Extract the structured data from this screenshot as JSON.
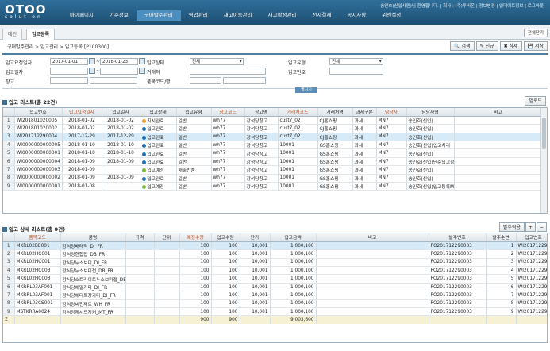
{
  "app": {
    "logo": "OTOO",
    "logo_sub": "solution",
    "user_info": "송인호(신입사원)님 환영합니다. | 회사 : (주)투비온 | 정보변경 | 업데이트정보 | 로그아웃"
  },
  "menu": [
    "마이페이지",
    "기준정보",
    "구매발주관리",
    "영업관리",
    "재고이동관리",
    "재고확정관리",
    "전자결재",
    "공지사항",
    "위젠설정"
  ],
  "tabs": {
    "home": "메인",
    "active": "입고등록",
    "fold": "전체닫기"
  },
  "breadcrumb": "구매발주관리 > 입고관리 > 입고등록 [P100300]",
  "toolbar": {
    "search": "검색",
    "new": "신규",
    "delete": "삭제",
    "save": "저장"
  },
  "search": {
    "receipt_date_label": "입고요청일자",
    "date_from": "2017-01-01",
    "tilde": "~",
    "date_to": "2018-01-23",
    "receipt_status_label": "입고상태",
    "receipt_status_value": "전체",
    "receipt_type_label": "입고유형",
    "receipt_type_value": "전체",
    "in_date_label": "입고일자",
    "client_label": "거래처",
    "in_no_label": "입고번호",
    "warehouse_label": "창고",
    "item_code_label": "품목코드/명",
    "expand": "펼치기"
  },
  "list": {
    "title": "입고 리스트(총 22건)",
    "upload": "업로드",
    "columns": [
      "입고번호",
      "입고요청일자",
      "입고일자",
      "입고상태",
      "입고유형",
      "창고코드",
      "창고명",
      "거래처코드",
      "거래처명",
      "과세구분",
      "담당자",
      "담당자명",
      "비고"
    ],
    "rows": [
      {
        "no": "1",
        "c": [
          "WI201801020005",
          "2018-01-02",
          "2018-01-02",
          "지시완료",
          "일반",
          "wh77",
          "강석당창고",
          "cust7_02",
          "CJ홈쇼핑",
          "과세",
          "MN7",
          "송인호(신입)",
          ""
        ],
        "dot": "#f0a030"
      },
      {
        "no": "2",
        "c": [
          "WI201801020002",
          "2018-01-02",
          "2018-01-02",
          "입고완료",
          "일반",
          "wh77",
          "강석당창고",
          "cust7_02",
          "CJ홈쇼핑",
          "과세",
          "MN7",
          "송인호(신입)",
          ""
        ],
        "dot": "#1f6fb8"
      },
      {
        "no": "3",
        "c": [
          "WI201712290004",
          "2017-12-29",
          "2017-12-29",
          "입고완료",
          "일반",
          "wh77",
          "강석당창고",
          "cust7_02",
          "CJ홈쇼핑",
          "과세",
          "MN7",
          "송인호(신입)",
          ""
        ],
        "dot": "#1f6fb8",
        "selected": true
      },
      {
        "no": "4",
        "c": [
          "WI0000000000005",
          "2018-01-10",
          "2018-01-10",
          "입고완료",
          "일반",
          "wh77",
          "강석당창고",
          "10001",
          "GS홈쇼핑",
          "과세",
          "MN7",
          "송인호(신입)입고처리",
          ""
        ],
        "dot": "#1f6fb8"
      },
      {
        "no": "5",
        "c": [
          "WI0000000000001",
          "2018-01-10",
          "2018-01-10",
          "입고완료",
          "일반",
          "wh77",
          "강석당창고",
          "10001",
          "GS홈쇼핑",
          "과세",
          "MN7",
          "송인호(신입)",
          ""
        ],
        "dot": "#1f6fb8"
      },
      {
        "no": "6",
        "c": [
          "WI0000000000004",
          "2018-01-09",
          "2018-01-09",
          "입고완료",
          "일반",
          "wh77",
          "강석당창고",
          "10001",
          "GS홈쇼핑",
          "과세",
          "MN7",
          "송인호(신입)단순입고함니다.",
          ""
        ],
        "dot": "#1f6fb8"
      },
      {
        "no": "7",
        "c": [
          "WI0000000000003",
          "2018-01-09",
          "",
          "입고예정",
          "매출반품",
          "wh77",
          "강석당창고",
          "10001",
          "GS홈쇼핑",
          "과세",
          "MN7",
          "송인호(신입)",
          ""
        ],
        "dot": "#7dbb3c"
      },
      {
        "no": "8",
        "c": [
          "WI0000000000002",
          "2018-01-09",
          "2018-01-09",
          "입고완료",
          "일반",
          "wh77",
          "강석당창고",
          "10001",
          "GS홈쇼핑",
          "과세",
          "MN7",
          "송인호(신입)",
          ""
        ],
        "dot": "#1f6fb8"
      },
      {
        "no": "9",
        "c": [
          "WI0000000000001",
          "2018-01-08",
          "",
          "입고예정",
          "일반",
          "wh77",
          "강석당창고",
          "10001",
          "GS홈쇼핑",
          "과세",
          "MN7",
          "송인호(신입)입고등록MSTT02",
          ""
        ],
        "dot": "#7dbb3c"
      }
    ]
  },
  "detail": {
    "title": "입고 상세 리스트(총 9건)",
    "confirm": "발주적용",
    "columns": [
      "품목코드",
      "품명",
      "규격",
      "단위",
      "예정수량",
      "입고수량",
      "단가",
      "입고금액",
      "비고",
      "발주번호",
      "발주순번",
      "입고번호"
    ],
    "rows": [
      {
        "no": "1",
        "c": [
          "MKRL02BE001",
          "강식당배래작_DI_FR",
          "",
          "",
          "100",
          "100",
          "10,001",
          "1,000,100",
          "",
          "PO201712290003",
          "1",
          "WI20171229"
        ],
        "selected": true
      },
      {
        "no": "2",
        "c": [
          "MKRL02HC001",
          "강식당현합접_DB_FR",
          "",
          "",
          "100",
          "100",
          "10,001",
          "1,000,100",
          "",
          "PO201712290003",
          "2",
          "WI20171229"
        ]
      },
      {
        "no": "3",
        "c": [
          "MKRL02HC001",
          "강식당누소보미_DI_FR",
          "",
          "",
          "100",
          "100",
          "10,001",
          "1,000,100",
          "",
          "PO201712290003",
          "3",
          "WI20171229"
        ]
      },
      {
        "no": "4",
        "c": [
          "MKRL02HC003",
          "강식당누소보미접_DB_FR",
          "",
          "",
          "100",
          "100",
          "10,001",
          "1,000,100",
          "",
          "PO201712290003",
          "4",
          "WI20171229"
        ]
      },
      {
        "no": "5",
        "c": [
          "MKRL02HC003",
          "강식당소트라이트누소보미접_DB",
          "",
          "",
          "100",
          "100",
          "10,001",
          "1,000,100",
          "",
          "PO201712290003",
          "5",
          "WI20171229"
        ]
      },
      {
        "no": "6",
        "c": [
          "MKRRL03AF001",
          "강식당해알카마_DI_FR",
          "",
          "",
          "100",
          "100",
          "10,001",
          "1,000,100",
          "",
          "PO201712290003",
          "6",
          "WI20171229"
        ]
      },
      {
        "no": "7",
        "c": [
          "MKRRL03AF001",
          "강식당해타트장카마_DI_FR",
          "",
          "",
          "100",
          "100",
          "10,001",
          "1,000,100",
          "",
          "PO201712290003",
          "7",
          "WI20171229"
        ]
      },
      {
        "no": "8",
        "c": [
          "MKRRL03CS001",
          "강식당씨전제트_WH_FR",
          "",
          "",
          "100",
          "100",
          "10,001",
          "1,000,100",
          "",
          "PO201712290003",
          "8",
          "WI20171229"
        ]
      },
      {
        "no": "9",
        "c": [
          "MSTKRRA0024",
          "강식당제시드지커_MT_FR",
          "",
          "",
          "100",
          "100",
          "10,001",
          "1,000,100",
          "",
          "PO201712290003",
          "9",
          "WI20171229"
        ]
      }
    ],
    "total": {
      "plan": "900",
      "qty": "900",
      "amount": "9,003,600"
    }
  }
}
